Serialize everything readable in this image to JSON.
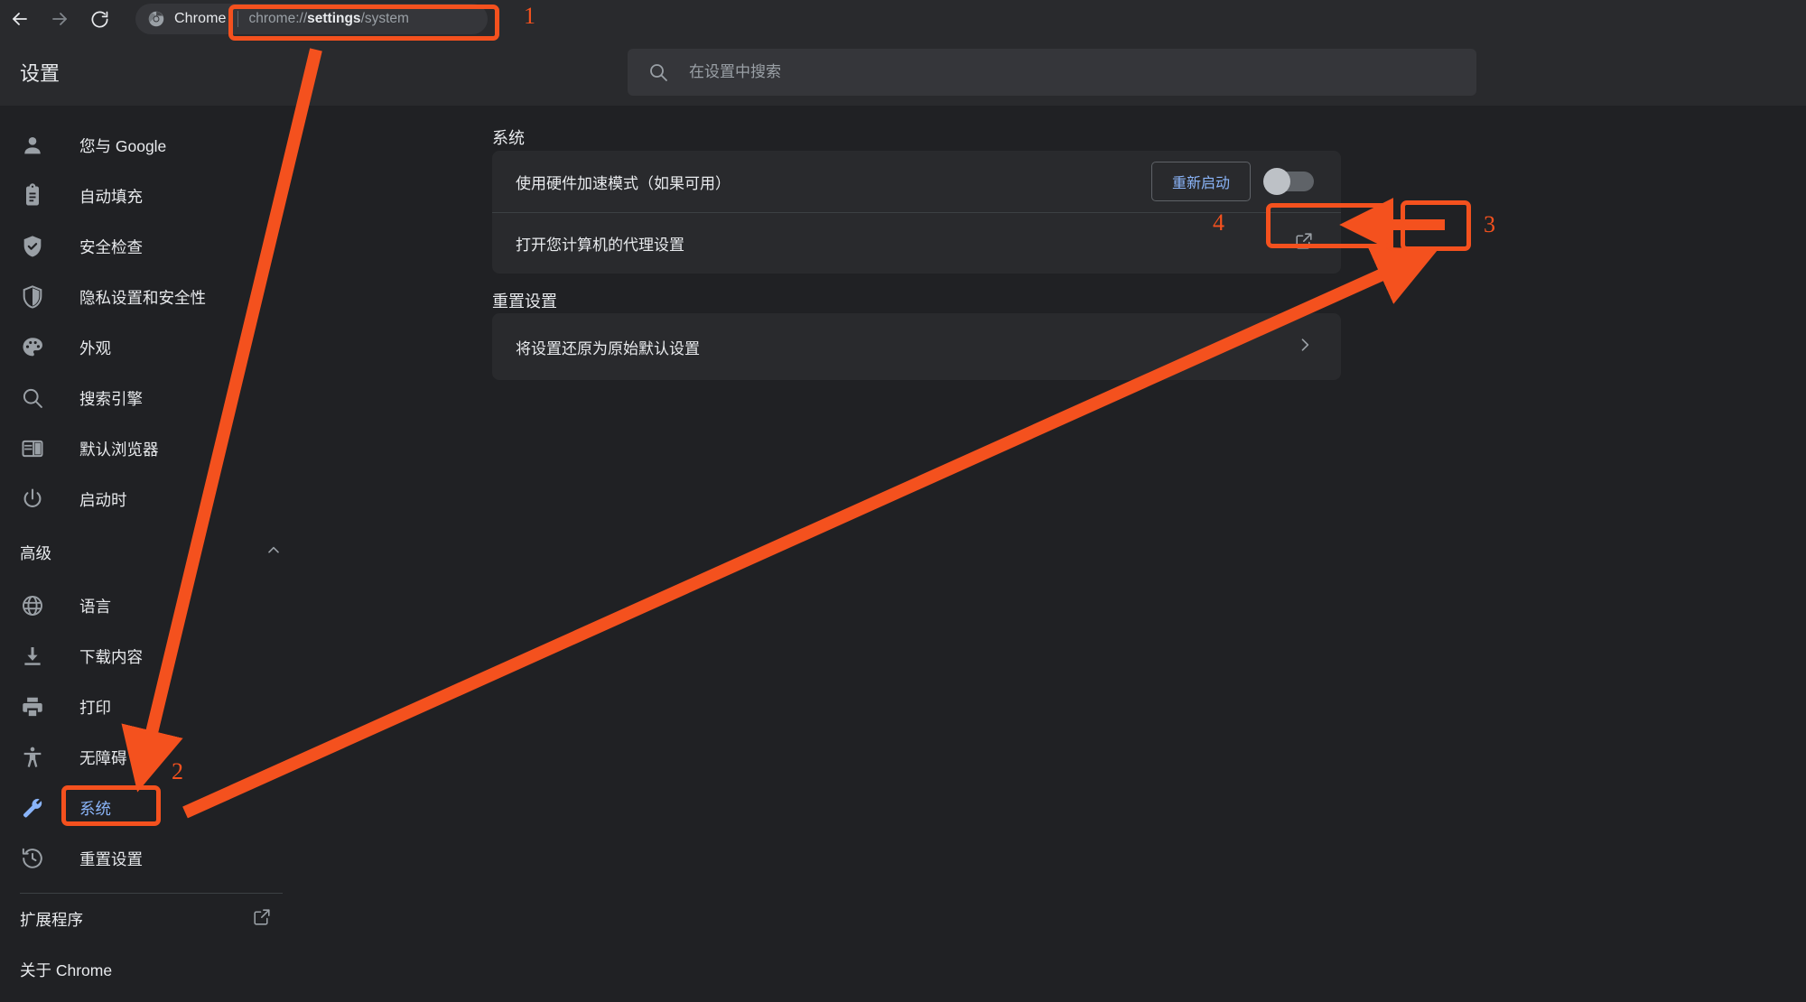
{
  "browser": {
    "back_icon": "arrow-left-icon",
    "forward_icon": "arrow-right-icon",
    "reload_icon": "reload-icon",
    "brand_label": "Chrome",
    "url_prefix": "chrome://",
    "url_bold": "settings",
    "url_suffix": "/system"
  },
  "header": {
    "title": "设置",
    "search_placeholder": "在设置中搜索",
    "search_value": ""
  },
  "sidebar": {
    "items": [
      {
        "label": "您与 Google",
        "icon": "person-icon"
      },
      {
        "label": "自动填充",
        "icon": "clipboard-icon"
      },
      {
        "label": "安全检查",
        "icon": "shield-check-icon"
      },
      {
        "label": "隐私设置和安全性",
        "icon": "shield-lock-icon"
      },
      {
        "label": "外观",
        "icon": "palette-icon"
      },
      {
        "label": "搜索引擎",
        "icon": "search-icon"
      },
      {
        "label": "默认浏览器",
        "icon": "browser-window-icon"
      },
      {
        "label": "启动时",
        "icon": "power-icon"
      }
    ],
    "advanced_label": "高级",
    "advanced_collapse_icon": "chevron-up-icon",
    "advanced_items": [
      {
        "label": "语言",
        "icon": "globe-icon"
      },
      {
        "label": "下载内容",
        "icon": "download-icon"
      },
      {
        "label": "打印",
        "icon": "printer-icon"
      },
      {
        "label": "无障碍",
        "icon": "accessibility-icon"
      },
      {
        "label": "系统",
        "icon": "wrench-icon",
        "active": true
      },
      {
        "label": "重置设置",
        "icon": "history-restore-icon"
      }
    ],
    "footer_items": [
      {
        "label": "扩展程序",
        "icon": "external-link-icon"
      },
      {
        "label": "关于 Chrome",
        "icon": ""
      }
    ]
  },
  "main": {
    "system_section_title": "系统",
    "hardware_accel_label": "使用硬件加速模式（如果可用）",
    "restart_button_label": "重新启动",
    "hardware_accel_toggle_state": "off",
    "proxy_label": "打开您计算机的代理设置",
    "proxy_icon": "external-link-icon",
    "reset_section_title": "重置设置",
    "reset_row_label": "将设置还原为原始默认设置",
    "reset_row_icon": "chevron-right-icon"
  },
  "annotations": {
    "accent_color": "#f4511e",
    "numbers": [
      "1",
      "2",
      "3",
      "4"
    ]
  }
}
